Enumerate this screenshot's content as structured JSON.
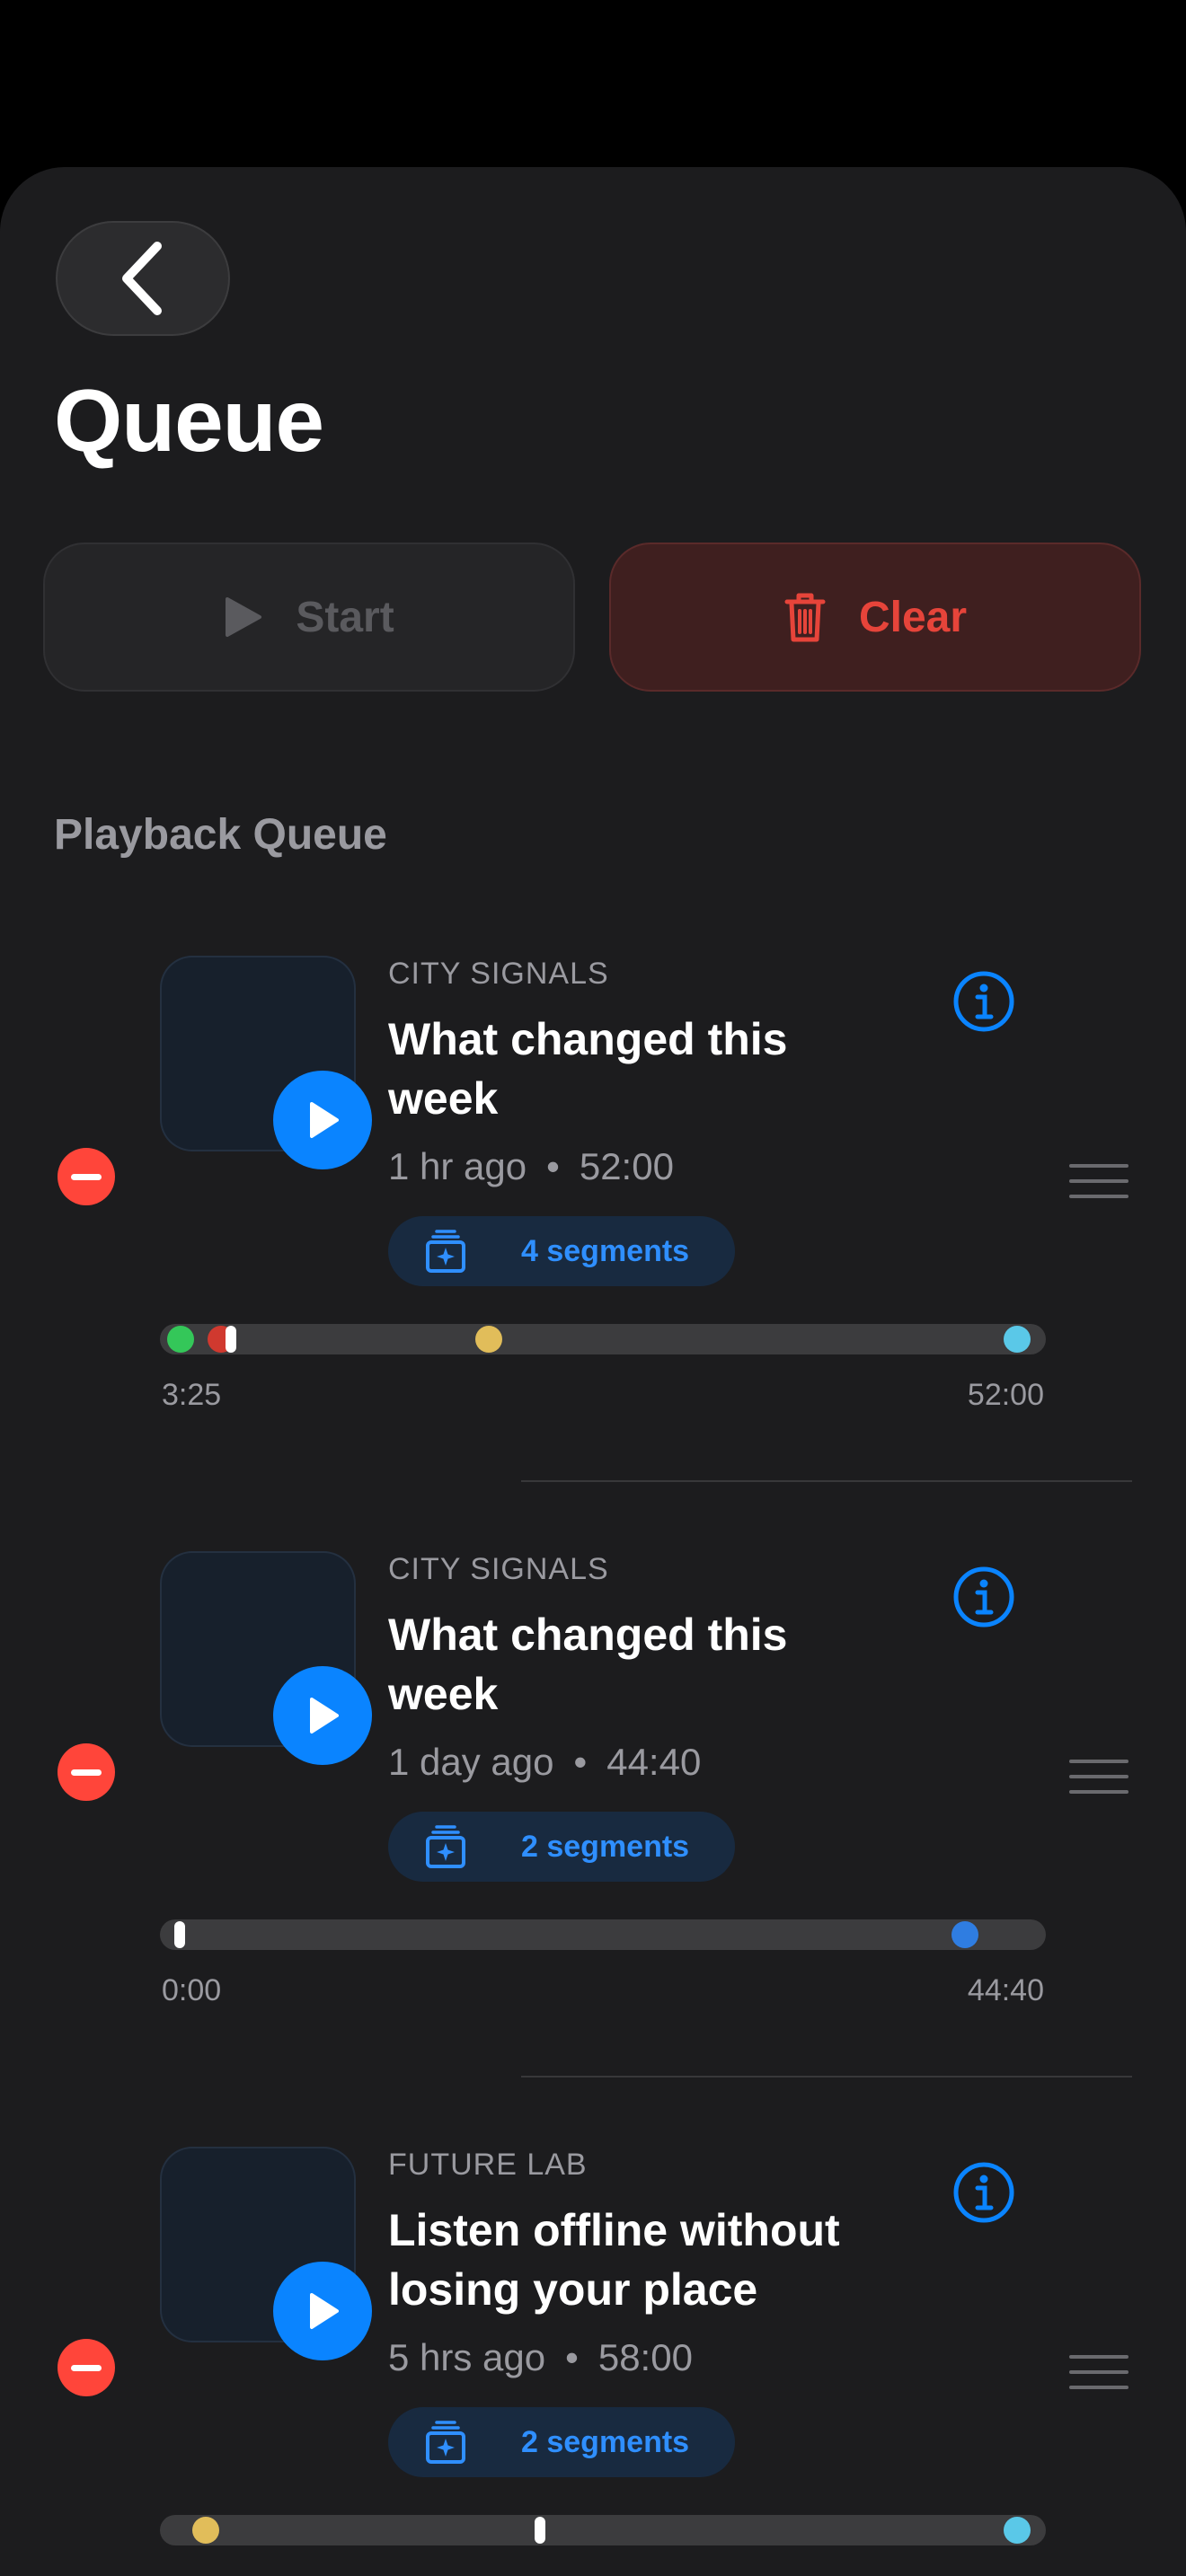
{
  "page": {
    "title": "Queue"
  },
  "actions": {
    "start_label": "Start",
    "clear_label": "Clear"
  },
  "section": {
    "label": "Playback Queue"
  },
  "colors": {
    "accent": "#0a84ff",
    "destructive": "#ff453a",
    "marker_green": "#34c759",
    "marker_red": "#d0392f",
    "marker_yellow": "#e1bd5a",
    "marker_cyan": "#5ac8e8",
    "marker_blue": "#2f7de1"
  },
  "queue": [
    {
      "show": "CITY SIGNALS",
      "title": "What changed this week",
      "age": "1 hr ago",
      "duration": "52:00",
      "segments_label": "4 segments",
      "time_left": "3:25",
      "time_right": "52:00",
      "markers": [
        {
          "pos": 0.007,
          "color": "marker_green",
          "shape": "circle"
        },
        {
          "pos": 0.055,
          "color": "marker_red",
          "shape": "circle"
        },
        {
          "pos": 0.066,
          "color": "white",
          "shape": "pill"
        },
        {
          "pos": 0.367,
          "color": "marker_yellow",
          "shape": "circle"
        },
        {
          "pos": 0.983,
          "color": "marker_cyan",
          "shape": "circle"
        }
      ]
    },
    {
      "show": "CITY SIGNALS",
      "title": "What changed this week",
      "age": "1 day ago",
      "duration": "44:40",
      "segments_label": "2 segments",
      "time_left": "0:00",
      "time_right": "44:40",
      "markers": [
        {
          "pos": 0.006,
          "color": "white",
          "shape": "pill"
        },
        {
          "pos": 0.922,
          "color": "marker_blue",
          "shape": "circle"
        }
      ]
    },
    {
      "show": "FUTURE LAB",
      "title": "Listen offline without losing your place",
      "age": "5 hrs ago",
      "duration": "58:00",
      "segments_label": "2 segments",
      "time_left": "",
      "time_right": "",
      "markers": [
        {
          "pos": 0.037,
          "color": "marker_yellow",
          "shape": "circle"
        },
        {
          "pos": 0.427,
          "color": "white",
          "shape": "pill"
        },
        {
          "pos": 0.983,
          "color": "marker_cyan",
          "shape": "circle"
        }
      ]
    }
  ]
}
